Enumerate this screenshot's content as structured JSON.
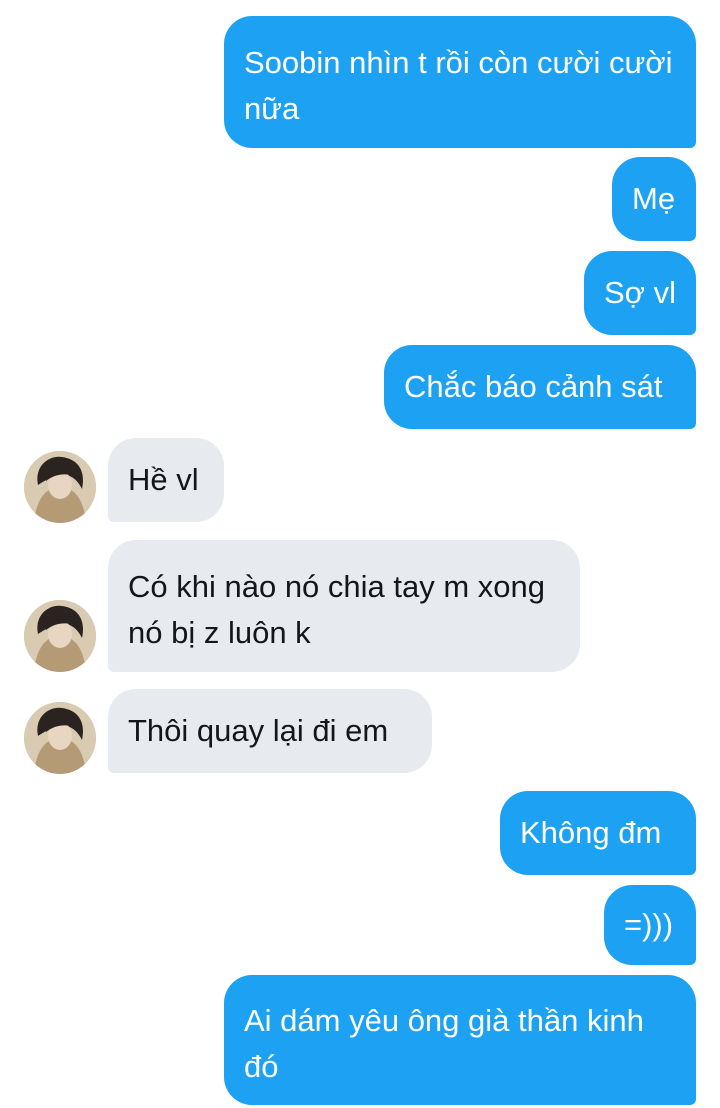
{
  "conversation": {
    "messages": [
      {
        "side": "out",
        "text": "Soobin nhìn t rồi còn cười cười nữa"
      },
      {
        "side": "out",
        "text": "Mẹ"
      },
      {
        "side": "out",
        "text": "Sợ vl"
      },
      {
        "side": "out",
        "text": "Chắc báo cảnh sát"
      },
      {
        "side": "in",
        "text": "Hề vl"
      },
      {
        "side": "in",
        "text": "Có khi nào nó chia tay m xong nó bị z luôn k"
      },
      {
        "side": "in",
        "text": "Thôi quay lại đi em"
      },
      {
        "side": "out",
        "text": "Không đm"
      },
      {
        "side": "out",
        "text": "=)))"
      },
      {
        "side": "out",
        "text": "Ai dám yêu ông già thần kinh đó"
      }
    ]
  },
  "colors": {
    "outgoing_bubble": "#1da1f2",
    "incoming_bubble": "#e7ebef",
    "incoming_text": "#14171a",
    "background": "#ffffff"
  },
  "icons": {
    "avatar": "contact-avatar-photo"
  }
}
